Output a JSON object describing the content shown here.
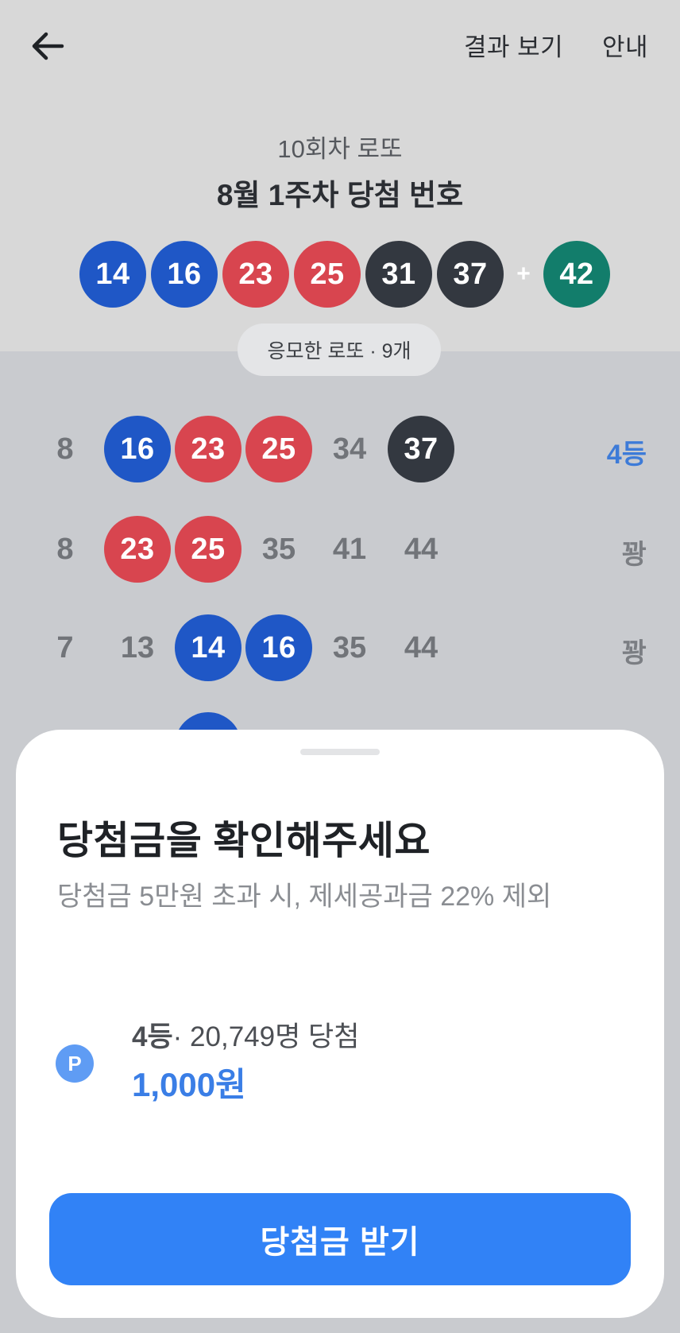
{
  "header": {
    "result_label": "결과 보기",
    "guide_label": "안내"
  },
  "draw": {
    "round_label": "10회차 로또",
    "week_title": "8월 1주차 당첨 번호",
    "numbers": [
      "14",
      "16",
      "23",
      "25",
      "31",
      "37"
    ],
    "plus": "+",
    "bonus": "42"
  },
  "entries_chip": "응모한 로또 · 9개",
  "tickets": [
    {
      "numbers": [
        "8",
        "16",
        "23",
        "25",
        "34",
        "37"
      ],
      "rank": "4등"
    },
    {
      "numbers": [
        "8",
        "23",
        "25",
        "35",
        "41",
        "44"
      ],
      "rank": "꽝"
    },
    {
      "numbers": [
        "7",
        "13",
        "14",
        "16",
        "35",
        "44"
      ],
      "rank": "꽝"
    }
  ],
  "sheet": {
    "title": "당첨금을 확인해주세요",
    "desc": "당첨금 5만원 초과 시, 제세공과금 22% 제외",
    "prize_icon": "P",
    "prize_rank": "4등",
    "prize_winners": "· 20,749명 당첨",
    "prize_amount": "1,000원",
    "claim_label": "당첨금 받기"
  },
  "colors": {
    "ball_blue": "#1f57c6",
    "ball_red": "#d8454f",
    "ball_dark": "#333840",
    "ball_green": "#127d6b",
    "accent": "#3182f6"
  }
}
